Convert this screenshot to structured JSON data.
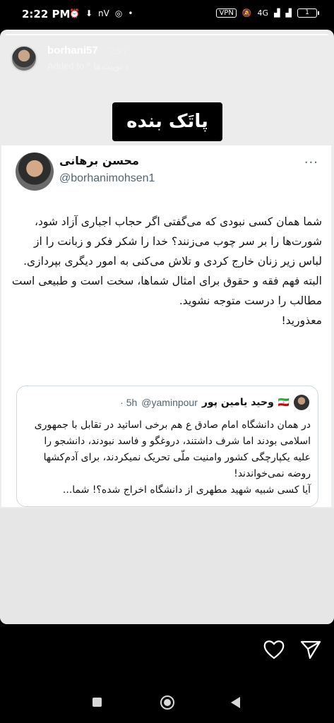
{
  "status_bar": {
    "time": "2:22 PM",
    "left_icons": [
      "alarm-icon",
      "download-icon",
      "battery-saver-icon"
    ],
    "nv_label": "nV",
    "vpn_label": "VPN",
    "network_label": "4G",
    "battery_level": "1"
  },
  "story": {
    "username": "borhani57",
    "time_ago": "23h",
    "added_to": "Added to ^ توییت‌ها",
    "sticker_text": "پاتَک بنده"
  },
  "tweet": {
    "display_name": "محسن برهانی",
    "handle": "@borhanimohsen1",
    "body": "شما همان کسی نبودی که می‌گفتی اگر حجاب اجباری آزاد شود، شورت‌ها را بر سر چوب می‌زنند؟ خدا را شکر فکر و زبانت را از لباس زیر زنان خارج کردی و تلاش می‌کنی به امور دیگری بپردازی.\nالبته فهم فقه و حقوق برای امثال شماها، سخت است و طبیعی است مطالب را درست متوجه نشوید.\nمعذورید!",
    "quote": {
      "display_name": "وحید یامین پور",
      "handle": "@yaminpour",
      "time": "· 5h",
      "body": "در همان دانشگاه امام صادق ع هم برخی اساتید در تقابل با جمهوری اسلامی بودند اما شرف داشتند، دروغگو و فاسد نبودند، دانشجو را علیه یکپارچگی کشور وامنیت ملّی تحریک نمیکردند، برای آدم‌کشها روضه نمی‌خواندند!\nآیا کسی شبیه شهید مطهری از دانشگاه اخراج شده؟! شما..."
    }
  },
  "colors": {
    "story_bg": "#ececec",
    "tweet_bg": "#ffffff",
    "handle_gray": "#536471",
    "border": "#cfd9de"
  }
}
